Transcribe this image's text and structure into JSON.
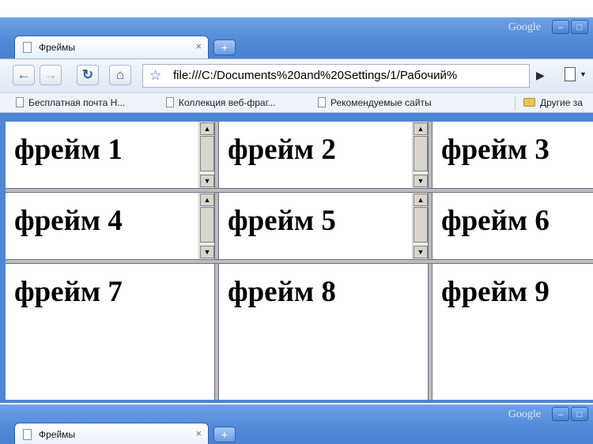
{
  "window": {
    "brand": "Google",
    "tab_title": "Фреймы",
    "tab_close": "×",
    "new_tab": "+",
    "minimize": "–",
    "maximize": "□"
  },
  "toolbar": {
    "back": "←",
    "forward": "→",
    "reload": "↻",
    "home": "⌂",
    "star": "☆",
    "url": "file:///C:/Documents%20and%20Settings/1/Рабочий%",
    "go": "▶",
    "menu_caret": "▼"
  },
  "bookmarks": [
    "Бесплатная почта Н...",
    "Коллекция веб-фраг...",
    "Рекомендуемые сайты"
  ],
  "other_bookmarks": "Другие за",
  "frames": [
    "фрейм 1",
    "фрейм 2",
    "фрейм 3",
    "фрейм 4",
    "фрейм 5",
    "фрейм 6",
    "фрейм 7",
    "фрейм 8",
    "фрейм 9"
  ],
  "scroll": {
    "up": "▲",
    "down": "▼"
  },
  "icons": [
    "page-icon",
    "close-icon",
    "new-tab-icon",
    "back-arrow-icon",
    "forward-arrow-icon",
    "reload-icon",
    "home-icon",
    "star-icon",
    "go-arrow-icon",
    "page-menu-icon",
    "folder-icon"
  ],
  "colors": {
    "chrome_blue": "#4c86d4",
    "frame_divider": "#b9bcc0",
    "scrollbar": "#d8d6cc"
  }
}
